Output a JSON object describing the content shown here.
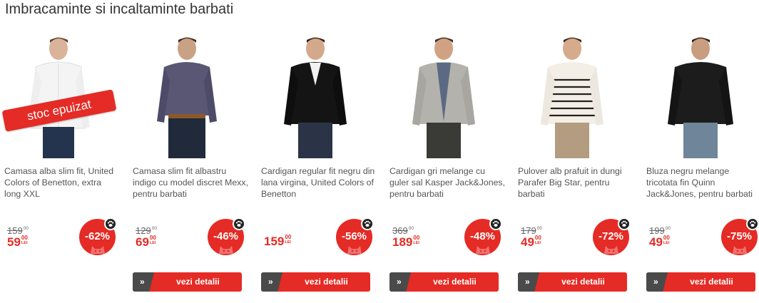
{
  "section_title": "Imbracaminte si incaltaminte barbati",
  "colors": {
    "accent": "#e52b25",
    "button_dark": "#4a4a4a",
    "old_price": "#666666"
  },
  "button_icon": "double-chevron-right-icon",
  "discount_icon": "cat-face-icon",
  "paw_icon": "paw-icon",
  "products": [
    {
      "description": "Camasa alba slim fit, United Colors of Benetton, extra long XXL",
      "old_price_int": "159",
      "old_price_dec": "00",
      "price_int": "59",
      "price_dec": "00",
      "currency": "LEI",
      "discount": "-62%",
      "sold_out": "stoc epuizat",
      "button_label": ""
    },
    {
      "description": "Camasa slim fit albastru indigo cu model discret Mexx, pentru barbati",
      "old_price_int": "129",
      "old_price_dec": "00",
      "price_int": "69",
      "price_dec": "00",
      "currency": "LEI",
      "discount": "-46%",
      "button_label": "vezi detalii"
    },
    {
      "description": "Cardigan regular fit negru din lana virgina, United Colors of Benetton",
      "old_price_int": "",
      "old_price_dec": "",
      "price_int": "159",
      "price_dec": "00",
      "currency": "LEI",
      "discount": "-56%",
      "button_label": "vezi detalii"
    },
    {
      "description": "Cardigan gri melange cu guler sal Kasper Jack&Jones, pentru barbati",
      "old_price_int": "369",
      "old_price_dec": "00",
      "price_int": "189",
      "price_dec": "00",
      "currency": "LEI",
      "discount": "-48%",
      "button_label": "vezi detalii"
    },
    {
      "description": "Pulover alb prafuit in dungi Parafer Big Star, pentru barbati",
      "old_price_int": "179",
      "old_price_dec": "00",
      "price_int": "49",
      "price_dec": "00",
      "currency": "LEI",
      "discount": "-72%",
      "button_label": "vezi detalii"
    },
    {
      "description": "Bluza negru melange tricotata fin Quinn Jack&Jones, pentru barbati",
      "old_price_int": "199",
      "old_price_dec": "00",
      "price_int": "49",
      "price_dec": "00",
      "currency": "LEI",
      "discount": "-75%",
      "button_label": "vezi detalii"
    }
  ]
}
